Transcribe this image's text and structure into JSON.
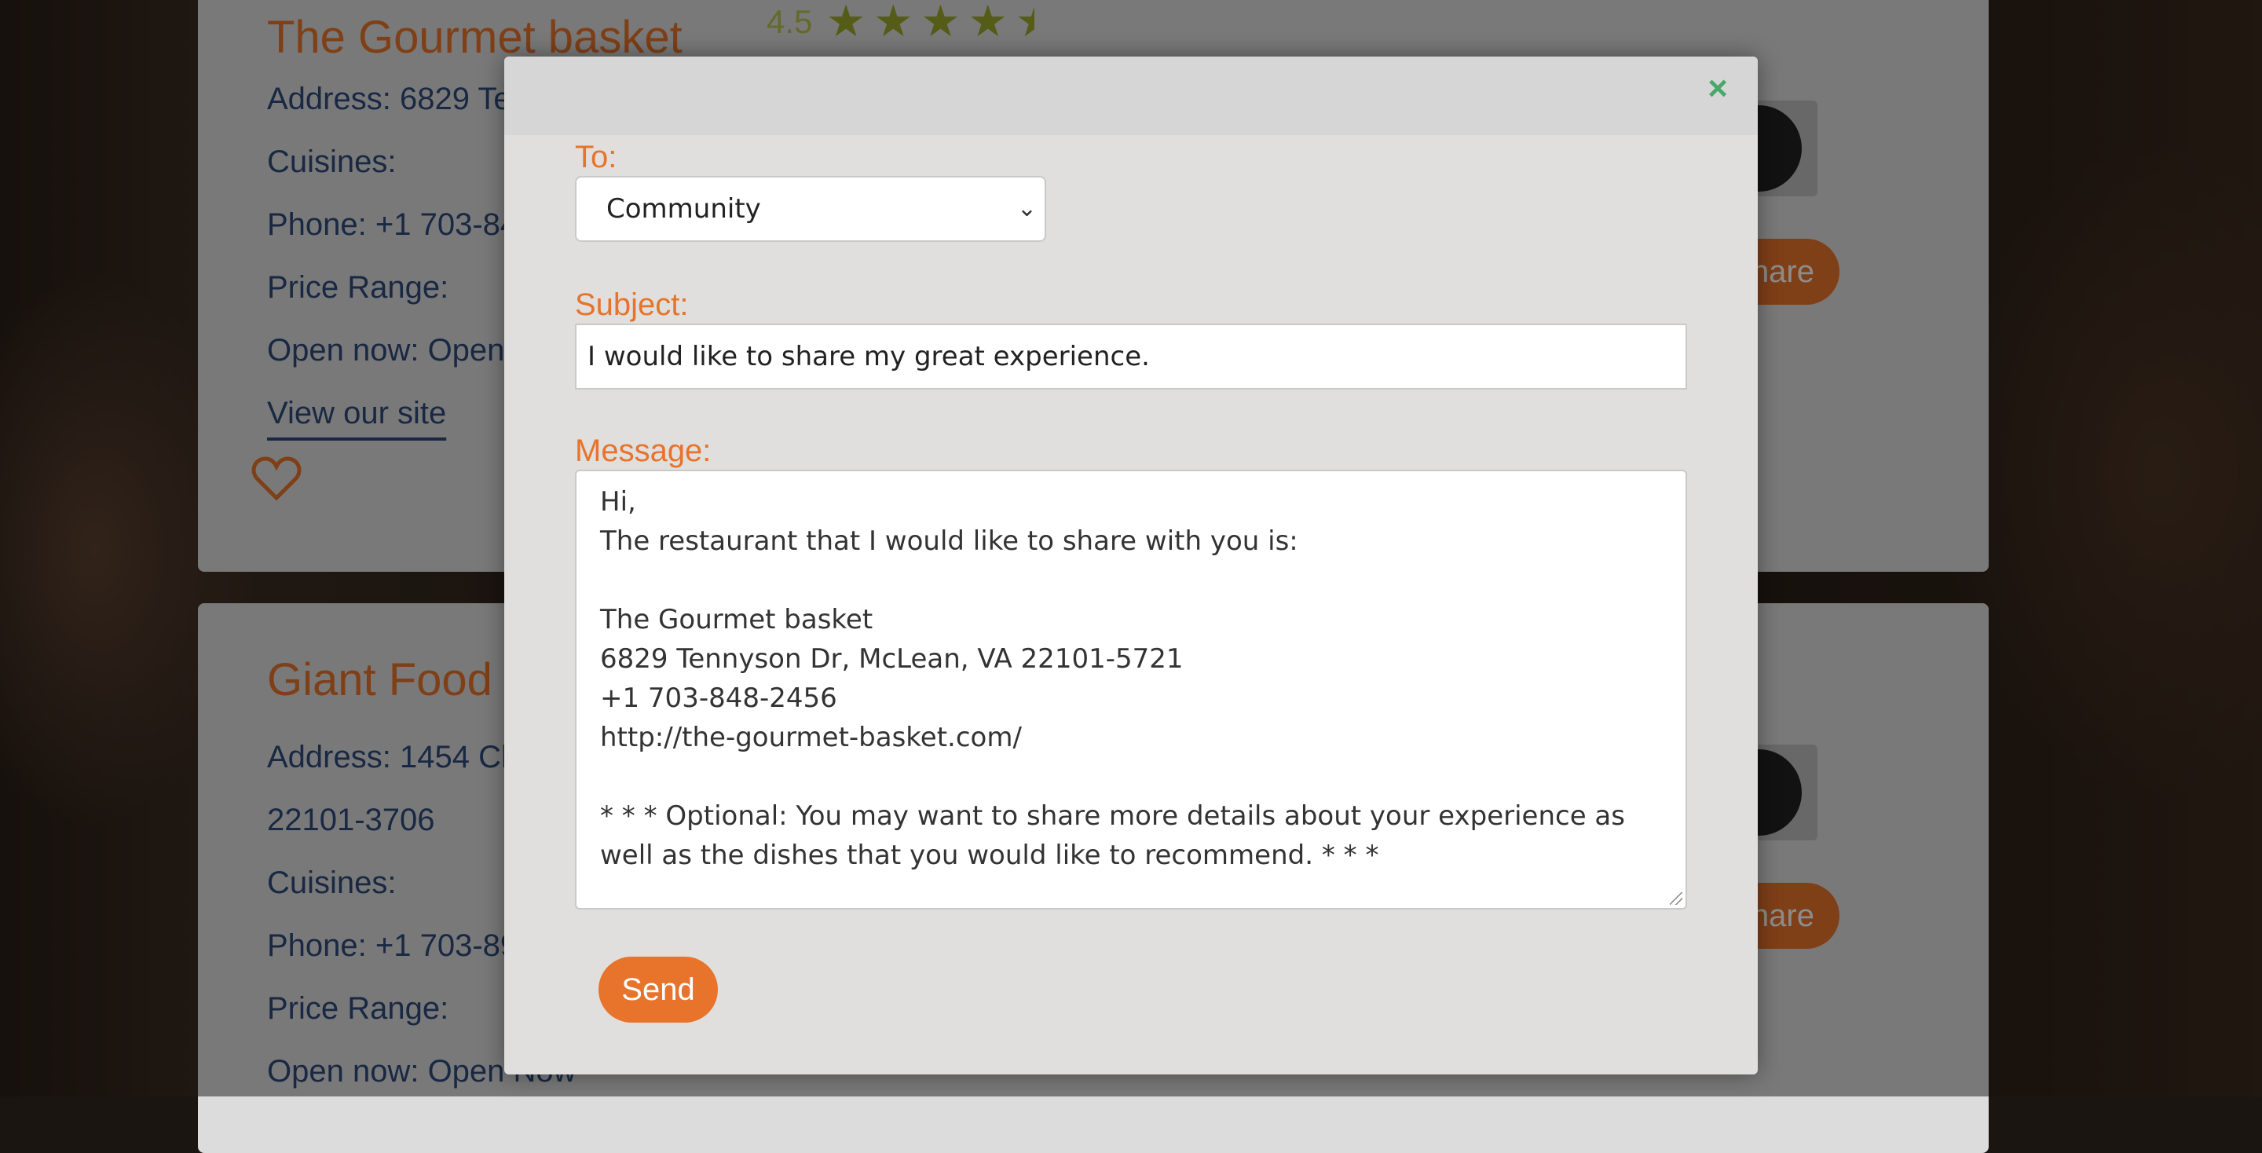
{
  "background": {
    "card1": {
      "name": "The Gourmet basket",
      "rating": "4.5",
      "stars_value": 4.5,
      "address": "Address: 6829 Te",
      "cuisines": "Cuisines:",
      "phone": "Phone: +1 703-84",
      "price_range": "Price Range:",
      "open_now": "Open now: Open",
      "site_link": "View our site",
      "share_label": "hare"
    },
    "card2": {
      "name": "Giant Food",
      "address": "Address: 1454 Ch",
      "zip": "22101-3706",
      "cuisines": "Cuisines:",
      "phone": "Phone: +1 703-89",
      "price_range": "Price Range:",
      "open_now": "Open now: Open Now",
      "share_label": "hare"
    }
  },
  "modal": {
    "close_label": "×",
    "to_label": "To:",
    "to_value": "Community",
    "subject_label": "Subject:",
    "subject_value": "I would like to share my great experience.",
    "message_label": "Message:",
    "message_value": "Hi,\nThe restaurant that I would like to share with you is:\n\nThe Gourmet basket\n6829 Tennyson Dr, McLean, VA 22101-5721\n+1 703-848-2456\nhttp://the-gourmet-basket.com/\n\n* * * Optional: You may want to share more details about your experience as well as the dishes that you would like to recommend. * * *",
    "send_label": "Send"
  },
  "colors": {
    "accent": "#e8732a",
    "text_blue": "#2f4a7a",
    "close_green": "#48a86a",
    "star": "#9aa82a"
  }
}
